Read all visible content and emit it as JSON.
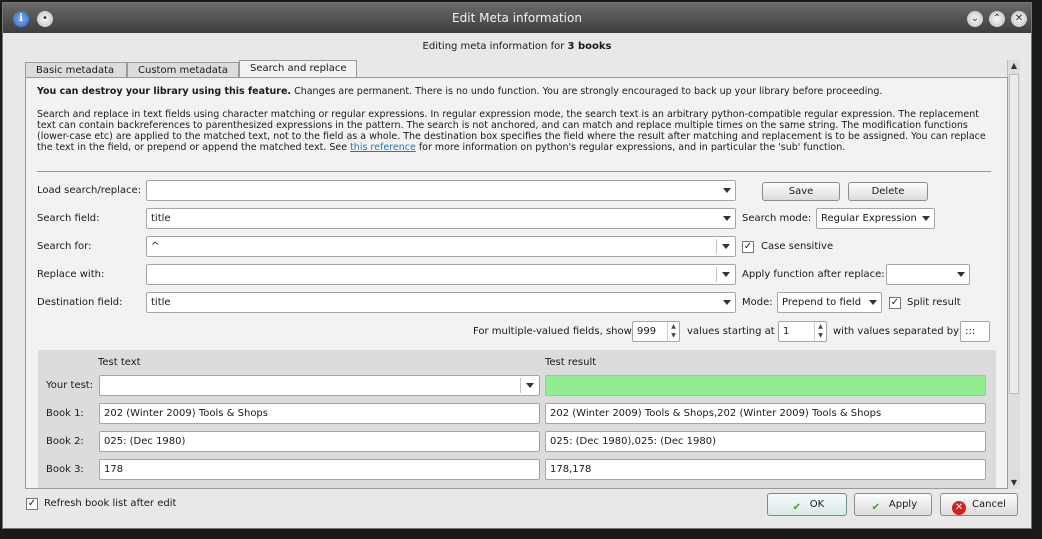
{
  "window": {
    "title": "Edit Meta information",
    "subheading_prefix": "Editing meta information for ",
    "subheading_bold": "3 books"
  },
  "tabs": [
    {
      "label": "Basic metadata",
      "active": false
    },
    {
      "label": "Custom metadata",
      "active": false
    },
    {
      "label": "Search and replace",
      "active": true
    }
  ],
  "warning": {
    "bold": "You can destroy your library using this feature.",
    "rest": " Changes are permanent. There is no undo function. You are strongly encouraged to back up your library before proceeding."
  },
  "description": {
    "text": "Search and replace in text fields using character matching or regular expressions. In regular expression mode, the search text is an arbitrary python-compatible regular expression. The replacement text can contain backreferences to parenthesized expressions in the pattern. The search is not anchored, and can match and replace multiple times on the same string. The modification functions (lower-case etc) are applied to the matched text, not to the field as a whole. The destination box specifies the field where the result after matching and replacement is to be assigned. You can replace the text in the field, or prepend or append the matched text. See ",
    "link": "this reference",
    "tail": " for more information on python's regular expressions, and in particular the 'sub' function."
  },
  "form": {
    "load_label": "Load search/replace:",
    "load_value": "",
    "save_label": "Save",
    "delete_label": "Delete",
    "search_field_label": "Search field:",
    "search_field_value": "title",
    "search_mode_label": "Search mode:",
    "search_mode_value": "Regular Expression",
    "search_for_label": "Search for:",
    "search_for_value": "^",
    "case_sensitive_label": "Case sensitive",
    "case_sensitive_checked": true,
    "replace_with_label": "Replace with:",
    "replace_with_value": "",
    "apply_function_label": "Apply function after replace:",
    "apply_function_value": "",
    "destination_label": "Destination field:",
    "destination_value": "title",
    "mode_label": "Mode:",
    "mode_value": "Prepend to field",
    "split_result_label": "Split result",
    "split_result_checked": true,
    "multi_label": "For multiple-valued fields, show",
    "multi_show_value": "999",
    "values_starting_label": "values starting at",
    "start_value": "1",
    "separated_label": "with values separated by",
    "separator_value": ":::"
  },
  "test": {
    "col_text": "Test text",
    "col_result": "Test result",
    "your_test_label": "Your test:",
    "your_test_value": "",
    "your_test_result": "",
    "books": [
      {
        "label": "Book 1:",
        "text": "202 (Winter 2009) Tools & Shops",
        "result": "202 (Winter 2009) Tools & Shops,202 (Winter 2009) Tools & Shops"
      },
      {
        "label": "Book 2:",
        "text": "025: (Dec 1980)",
        "result": "025: (Dec 1980),025: (Dec 1980)"
      },
      {
        "label": "Book 3:",
        "text": "178",
        "result": "178,178"
      }
    ]
  },
  "footer": {
    "refresh_label": "Refresh book list after edit",
    "refresh_checked": true,
    "ok_label": "OK",
    "apply_label": "Apply",
    "cancel_label": "Cancel"
  },
  "colors": {
    "test_result_highlight": "#90ee90",
    "link": "#1a7fb5",
    "cancel_icon": "#d32020"
  }
}
